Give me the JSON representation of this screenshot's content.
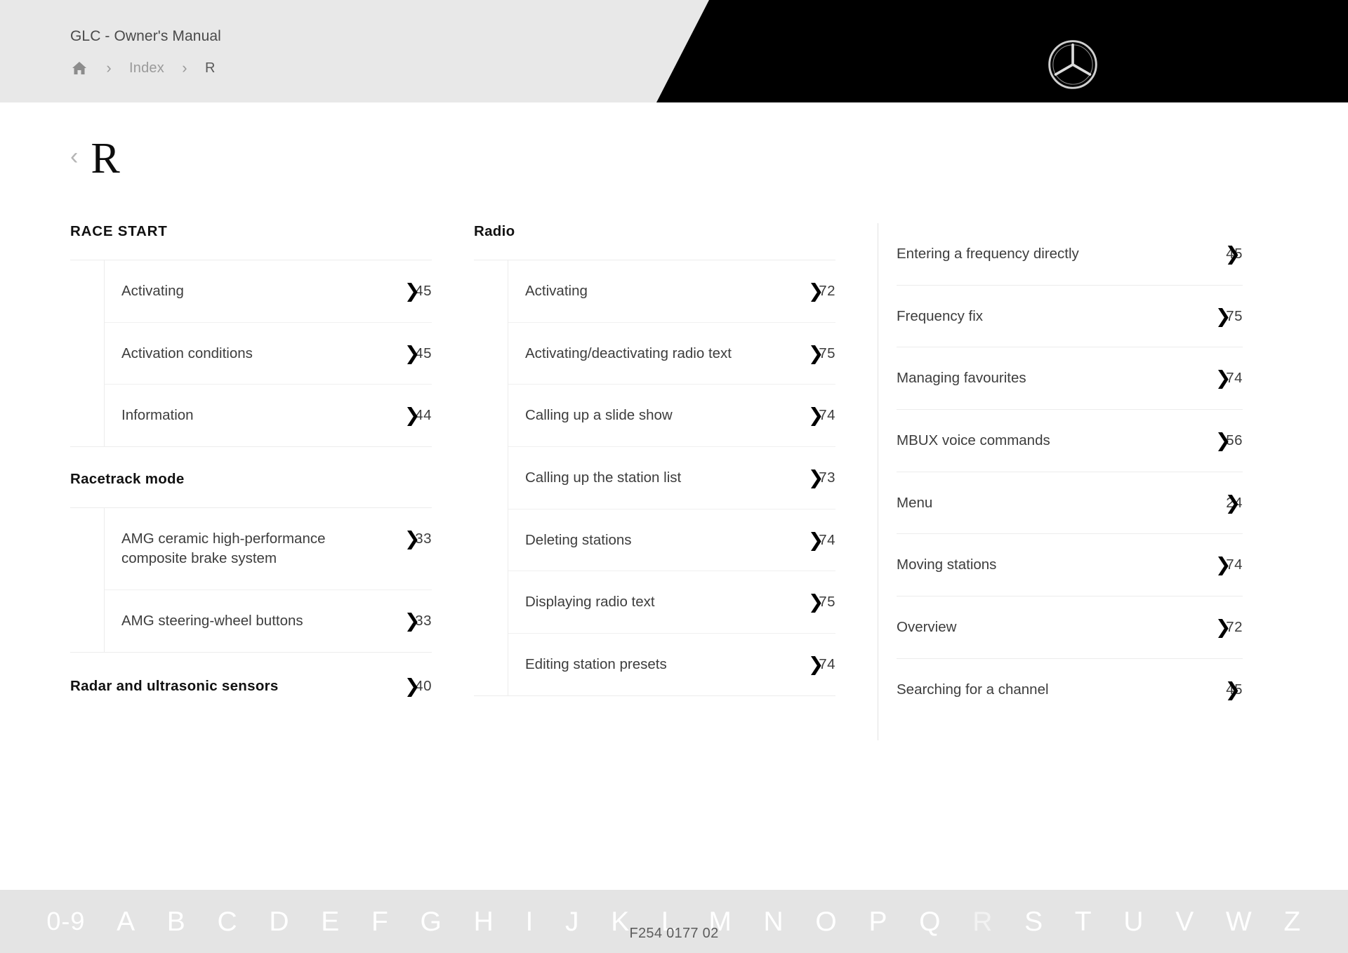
{
  "header": {
    "manual_title": "GLC - Owner's Manual",
    "breadcrumb": {
      "home_icon": "home-icon",
      "separator": "›",
      "index_label": "Index",
      "current_label": "R"
    },
    "logo_icon": "mercedes-benz-star-logo"
  },
  "page": {
    "back_chevron": "‹",
    "title": "R"
  },
  "columns": [
    {
      "blocks": [
        {
          "type": "group",
          "title": "RACE START",
          "uppercase": true,
          "indented": true,
          "entries": [
            {
              "label": "Activating",
              "page": "45",
              "short": false
            },
            {
              "label": "Activation conditions",
              "page": "45",
              "short": false
            },
            {
              "label": "Information",
              "page": "44",
              "short": false
            }
          ]
        },
        {
          "type": "group",
          "title": "Racetrack mode",
          "uppercase": false,
          "indented": true,
          "entries": [
            {
              "label": "AMG ceramic high-performance composite brake system",
              "page": "33",
              "short": false
            },
            {
              "label": "AMG steering-wheel buttons",
              "page": "33",
              "short": false
            }
          ]
        },
        {
          "type": "titled-row",
          "title": "Radar and ultrasonic sensors",
          "page": "40",
          "short": false
        }
      ]
    },
    {
      "blocks": [
        {
          "type": "group",
          "title": "Radio",
          "uppercase": false,
          "indented": true,
          "entries": [
            {
              "label": "Activating",
              "page": "72",
              "short": false
            },
            {
              "label": "Activating/deactivating radio text",
              "page": "75",
              "short": false
            },
            {
              "label": "Calling up a slide show",
              "page": "74",
              "short": false
            },
            {
              "label": "Calling up the station list",
              "page": "73",
              "short": false
            },
            {
              "label": "Deleting stations",
              "page": "74",
              "short": false
            },
            {
              "label": "Displaying radio text",
              "page": "75",
              "short": false
            },
            {
              "label": "Editing station presets",
              "page": "74",
              "short": false
            }
          ]
        }
      ]
    },
    {
      "blocks": [
        {
          "type": "flat",
          "entries": [
            {
              "label": "Entering a frequency directly",
              "page": "45",
              "short": true
            },
            {
              "label": "Frequency fix",
              "page": "75",
              "short": false
            },
            {
              "label": "Managing favourites",
              "page": "74",
              "short": false
            },
            {
              "label": "MBUX voice commands",
              "page": "56",
              "short": false
            },
            {
              "label": "Menu",
              "page": "24",
              "short": true
            },
            {
              "label": "Moving stations",
              "page": "74",
              "short": false
            },
            {
              "label": "Overview",
              "page": "72",
              "short": false
            },
            {
              "label": "Searching for a channel",
              "page": "45",
              "short": true
            }
          ]
        }
      ]
    }
  ],
  "alphabet_bar": {
    "letters": [
      "0-9",
      "A",
      "B",
      "C",
      "D",
      "E",
      "F",
      "G",
      "H",
      "I",
      "J",
      "K",
      "L",
      "M",
      "N",
      "O",
      "P",
      "Q",
      "R",
      "S",
      "T",
      "U",
      "V",
      "W",
      "Z"
    ],
    "active": "R"
  },
  "footer": {
    "document_code": "F254 0177 02"
  }
}
